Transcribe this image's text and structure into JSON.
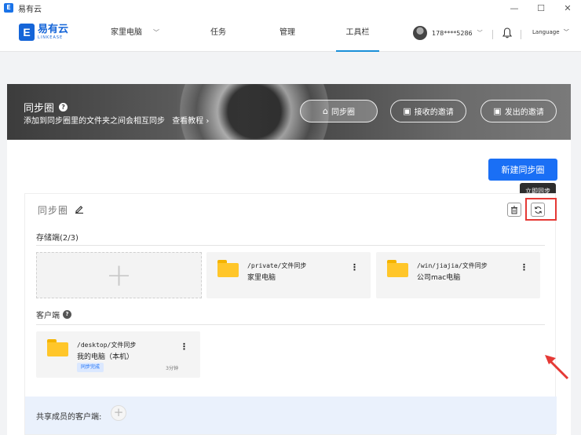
{
  "window": {
    "title": "易有云",
    "controls": [
      "—",
      "☐",
      "✕"
    ]
  },
  "nav": {
    "logo_cn": "易有云",
    "logo_en": "LINKEASE",
    "items": [
      "家里电脑",
      "任务",
      "管理",
      "工具栏"
    ],
    "active": "工具栏",
    "user_phone": "178****5286",
    "language": "Language"
  },
  "banner": {
    "title": "同步圈",
    "subtitle": "添加到同步圈里的文件夹之间会相互同步",
    "tutorial_link": "查看教程 ›",
    "tabs": [
      "同步圈",
      "接收的邀请",
      "发出的邀请"
    ],
    "active_tab": "同步圈"
  },
  "main": {
    "new_button": "新建同步圈",
    "tooltip": "立即同步",
    "circle": {
      "name": "同步圈",
      "storage_label": "存储端(2/3)",
      "storage": [
        {
          "path": "/private/文件同步",
          "device": "家里电脑"
        },
        {
          "path": "/win/jiajia/文件同步",
          "device": "公司mac电脑"
        }
      ],
      "client_label": "客户端",
      "clients": [
        {
          "path": "/desktop/文件同步",
          "device": "我的电脑（本机）",
          "status": "同步完成",
          "time": "3分钟"
        }
      ],
      "shared_label": "共享成员的客户端:"
    }
  },
  "colors": {
    "accent": "#1a6ff5",
    "nav_active": "#1a8fd8",
    "highlight": "#e53935",
    "folder": "#ffc62a"
  }
}
